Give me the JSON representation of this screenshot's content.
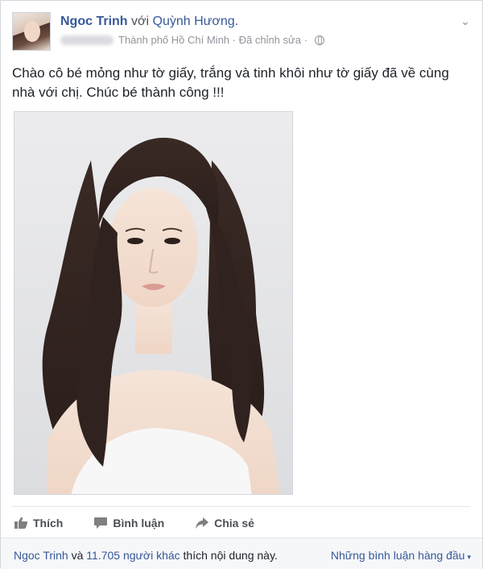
{
  "post": {
    "author": "Ngoc Trinh",
    "with_word": "với",
    "tagged": "Quỳnh Hương.",
    "location": "Thành phố Hồ Chí Minh",
    "separator": " · ",
    "edited": "Đã chỉnh sửa",
    "separator2": " · ",
    "text": "Chào cô bé mỏng như tờ giấy, trắng và tinh khôi như tờ giấy đã về cùng nhà với chị. Chúc bé thành công !!!"
  },
  "actions": {
    "like": "Thích",
    "comment": "Bình luận",
    "share": "Chia sẻ"
  },
  "footer": {
    "liker": "Ngoc Trinh",
    "and": "và",
    "others": "11.705 người khác",
    "likes_text": "thích nội dung này.",
    "top_comments": "Những bình luận hàng đầu",
    "caret": "▾"
  },
  "icons": {
    "menu": "chevron-down-icon",
    "privacy": "globe-icon",
    "like": "thumbs-up-icon",
    "comment": "speech-bubble-icon",
    "share": "share-arrow-icon"
  },
  "colors": {
    "link": "#365899",
    "action": "#4b4f56",
    "meta": "#90949c"
  }
}
